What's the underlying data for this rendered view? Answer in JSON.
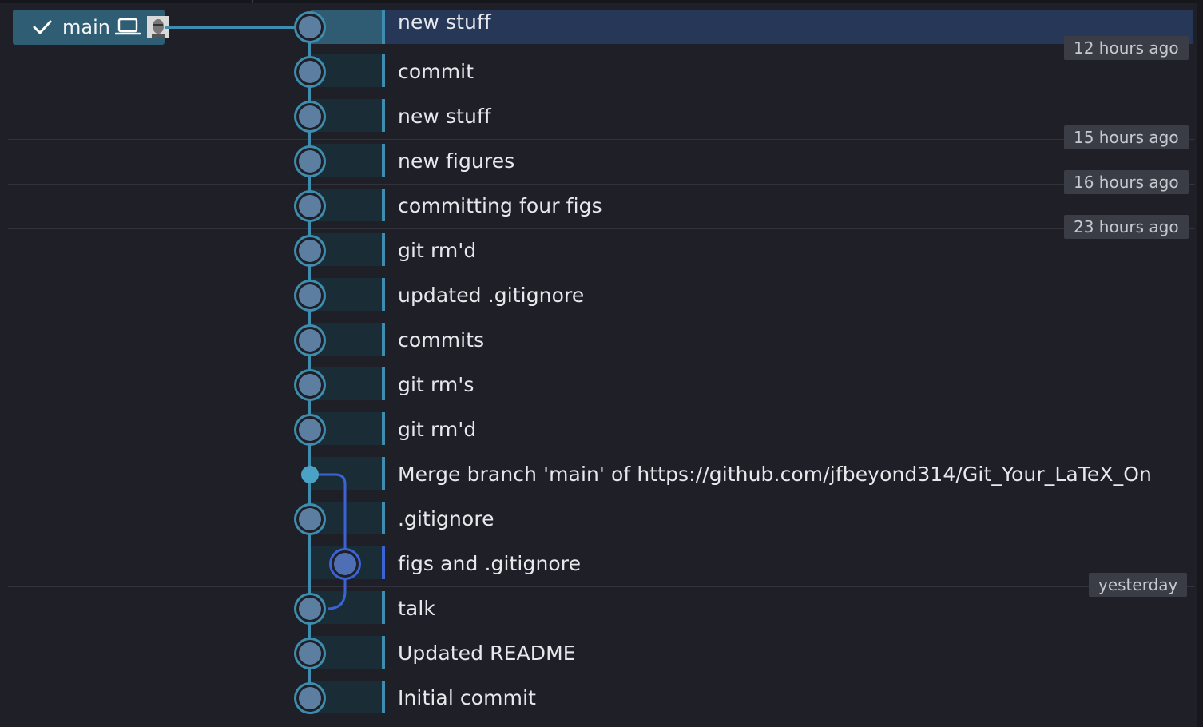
{
  "branch": {
    "name": "main",
    "icons": [
      "check-icon",
      "laptop-icon",
      "avatar-icon"
    ]
  },
  "commits": [
    {
      "message": "new stuff",
      "time_label": "12 hours ago",
      "selected": true
    },
    {
      "message": "commit",
      "time_label": ""
    },
    {
      "message": "new stuff",
      "time_label": "15 hours ago"
    },
    {
      "message": "new figures",
      "time_label": "16 hours ago"
    },
    {
      "message": "committing four figs",
      "time_label": "23 hours ago"
    },
    {
      "message": "git rm'd",
      "time_label": ""
    },
    {
      "message": "updated .gitignore",
      "time_label": ""
    },
    {
      "message": "commits",
      "time_label": ""
    },
    {
      "message": "git rm's",
      "time_label": ""
    },
    {
      "message": "git rm'd",
      "time_label": ""
    },
    {
      "message": "Merge branch 'main' of https://github.com/jfbeyond314/Git_Your_LaTeX_On",
      "time_label": "",
      "merge": true
    },
    {
      "message": ".gitignore",
      "time_label": ""
    },
    {
      "message": "figs and .gitignore",
      "time_label": "",
      "lane": 2
    },
    {
      "message": "talk",
      "time_label": "yesterday"
    },
    {
      "message": "Updated README",
      "time_label": ""
    },
    {
      "message": "Initial commit",
      "time_label": ""
    }
  ],
  "colors": {
    "background": "#1f2027",
    "lane_main": "#3e8dae",
    "lane_branch": "#3b63d6",
    "selected_row": "#263757",
    "time_badge": "#3a3d45"
  }
}
